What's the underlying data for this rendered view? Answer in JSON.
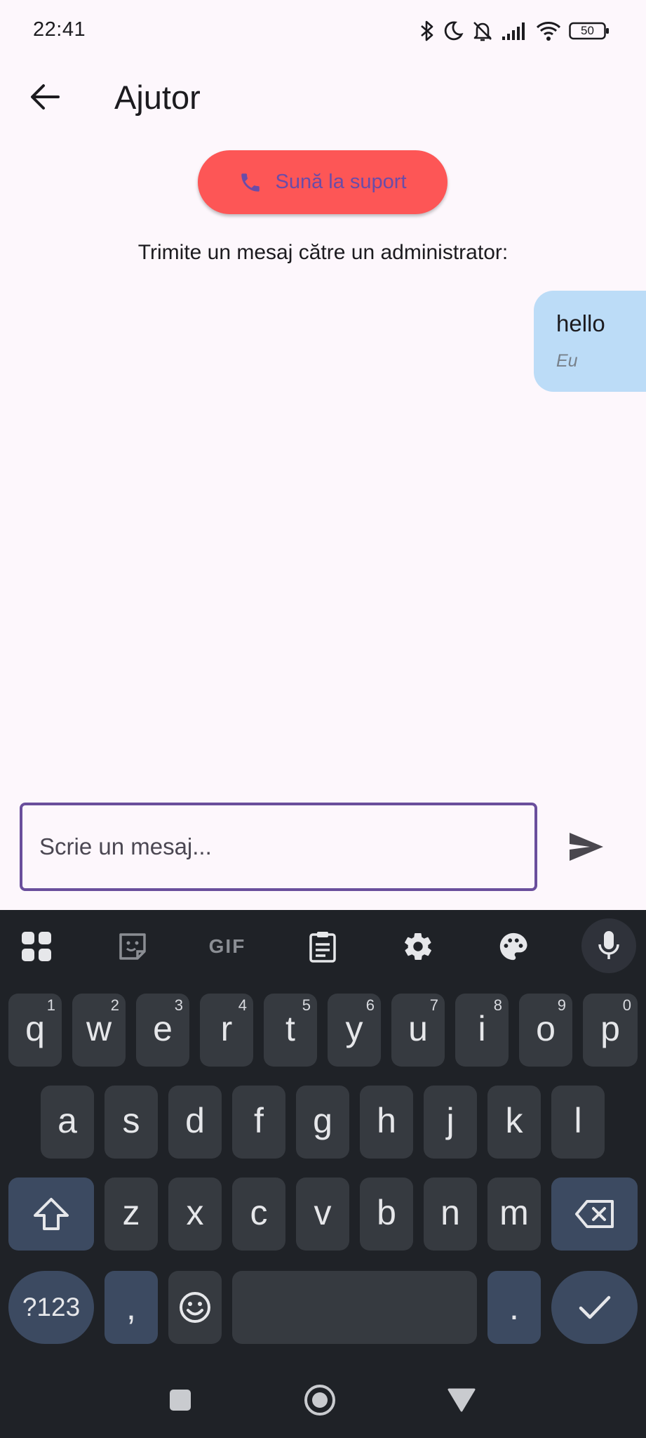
{
  "status_bar": {
    "time": "22:41",
    "battery": "50",
    "icons": [
      "bluetooth-icon",
      "moon-icon",
      "bell-off-icon",
      "signal-icon",
      "wifi-icon",
      "battery-icon"
    ]
  },
  "app_bar": {
    "title": "Ajutor",
    "back_icon": "arrow-left-icon"
  },
  "support_button": {
    "label": "Sună la suport",
    "icon": "phone-icon",
    "background_color": "#fd5656",
    "text_color": "#6a4ca8"
  },
  "instructions": "Trimite un mesaj către un administrator:",
  "messages": [
    {
      "text": "hello",
      "sender": "Eu",
      "bubble_color": "#bcdcf7"
    }
  ],
  "composer": {
    "placeholder": "Scrie un mesaj...",
    "value": "",
    "send_icon": "send-icon",
    "border_color": "#6a4f9c"
  },
  "keyboard": {
    "toolbar": [
      "apps-grid-icon",
      "sticker-icon",
      "gif-icon",
      "clipboard-icon",
      "gear-icon",
      "palette-icon",
      "mic-icon"
    ],
    "toolbar_gif_label": "GIF",
    "row1": [
      {
        "key": "q",
        "hint": "1"
      },
      {
        "key": "w",
        "hint": "2"
      },
      {
        "key": "e",
        "hint": "3"
      },
      {
        "key": "r",
        "hint": "4"
      },
      {
        "key": "t",
        "hint": "5"
      },
      {
        "key": "y",
        "hint": "6"
      },
      {
        "key": "u",
        "hint": "7"
      },
      {
        "key": "i",
        "hint": "8"
      },
      {
        "key": "o",
        "hint": "9"
      },
      {
        "key": "p",
        "hint": "0"
      }
    ],
    "row2": [
      "a",
      "s",
      "d",
      "f",
      "g",
      "h",
      "j",
      "k",
      "l"
    ],
    "row3": [
      "z",
      "x",
      "c",
      "v",
      "b",
      "n",
      "m"
    ],
    "symbols_label": "?123",
    "comma_label": ",",
    "period_label": ".",
    "emoji_icon": "emoji-icon",
    "shift_icon": "shift-icon",
    "backspace_icon": "backspace-icon",
    "enter_icon": "check-icon"
  },
  "nav_bar": [
    "recents-square-icon",
    "home-circle-icon",
    "back-triangle-icon"
  ]
}
